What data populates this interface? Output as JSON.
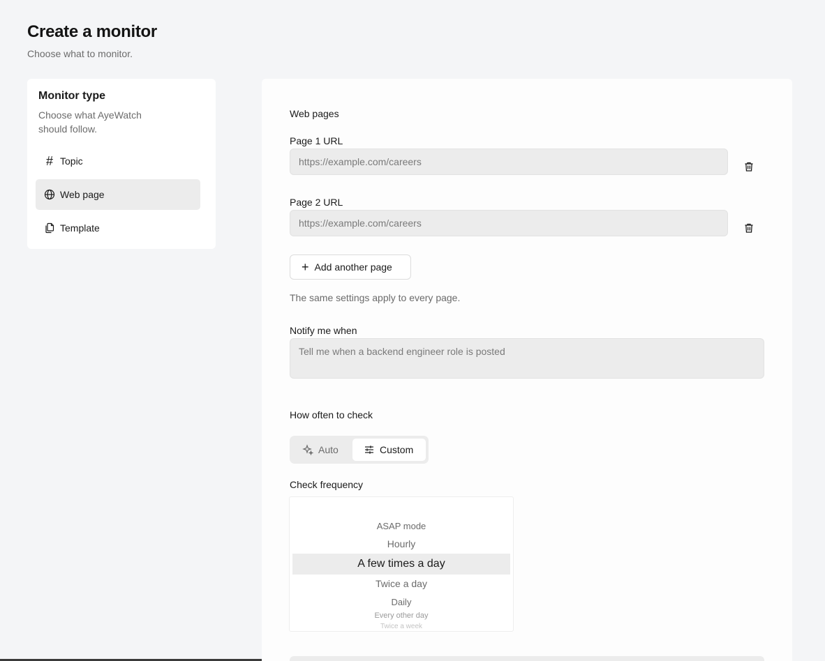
{
  "header": {
    "title": "Create a monitor",
    "subtitle": "Choose what to monitor."
  },
  "monitor_type": {
    "title": "Monitor type",
    "description": "Choose what AyeWatch should follow.",
    "items": [
      {
        "label": "Topic",
        "icon": "hash-icon",
        "active": false
      },
      {
        "label": "Web page",
        "icon": "globe-icon",
        "active": true
      },
      {
        "label": "Template",
        "icon": "copy-icon",
        "active": false
      }
    ]
  },
  "form": {
    "section_title": "Web pages",
    "pages": [
      {
        "label": "Page 1 URL",
        "placeholder": "https://example.com/careers",
        "value": ""
      },
      {
        "label": "Page 2 URL",
        "placeholder": "https://example.com/careers",
        "value": ""
      }
    ],
    "add_page_label": "Add another page",
    "helper_text": "The same settings apply to every page.",
    "notify": {
      "label": "Notify me when",
      "placeholder": "Tell me when a backend engineer role is posted"
    },
    "frequency": {
      "label": "How often to check",
      "modes": [
        {
          "label": "Auto",
          "icon": "sparkle-icon",
          "selected": false
        },
        {
          "label": "Custom",
          "icon": "sliders-icon",
          "selected": true
        }
      ]
    },
    "check_frequency": {
      "label": "Check frequency",
      "options": [
        "ASAP mode",
        "Hourly",
        "A few times a day",
        "Twice a day",
        "Daily",
        "Every other day",
        "Twice a week"
      ],
      "selected": "A few times a day"
    }
  }
}
